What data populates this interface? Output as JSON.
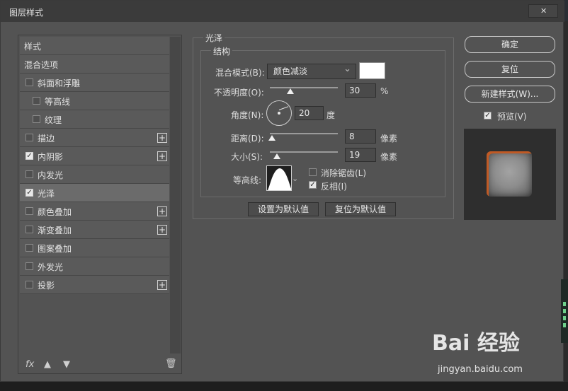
{
  "dialog": {
    "title": "图层样式"
  },
  "left_list": {
    "items": [
      {
        "label": "样式",
        "checkbox": false,
        "checked": false,
        "plus": false,
        "indent": 0,
        "selected": false
      },
      {
        "label": "混合选项",
        "checkbox": false,
        "checked": false,
        "plus": false,
        "indent": 0,
        "selected": false
      },
      {
        "label": "斜面和浮雕",
        "checkbox": true,
        "checked": false,
        "plus": false,
        "indent": 0,
        "selected": false
      },
      {
        "label": "等高线",
        "checkbox": true,
        "checked": false,
        "plus": false,
        "indent": 1,
        "selected": false
      },
      {
        "label": "纹理",
        "checkbox": true,
        "checked": false,
        "plus": false,
        "indent": 1,
        "selected": false
      },
      {
        "label": "描边",
        "checkbox": true,
        "checked": false,
        "plus": true,
        "indent": 0,
        "selected": false
      },
      {
        "label": "内阴影",
        "checkbox": true,
        "checked": true,
        "plus": true,
        "indent": 0,
        "selected": false
      },
      {
        "label": "内发光",
        "checkbox": true,
        "checked": false,
        "plus": false,
        "indent": 0,
        "selected": false
      },
      {
        "label": "光泽",
        "checkbox": true,
        "checked": true,
        "plus": false,
        "indent": 0,
        "selected": true
      },
      {
        "label": "颜色叠加",
        "checkbox": true,
        "checked": false,
        "plus": true,
        "indent": 0,
        "selected": false
      },
      {
        "label": "渐变叠加",
        "checkbox": true,
        "checked": false,
        "plus": true,
        "indent": 0,
        "selected": false
      },
      {
        "label": "图案叠加",
        "checkbox": true,
        "checked": false,
        "plus": false,
        "indent": 0,
        "selected": false
      },
      {
        "label": "外发光",
        "checkbox": true,
        "checked": false,
        "plus": false,
        "indent": 0,
        "selected": false
      },
      {
        "label": "投影",
        "checkbox": true,
        "checked": false,
        "plus": true,
        "indent": 0,
        "selected": false
      }
    ],
    "footer": {
      "fx_label": "fx",
      "icons": [
        "move-up-icon",
        "move-down-icon",
        "trash-icon"
      ]
    }
  },
  "satin": {
    "group_title": "光泽",
    "structure_title": "结构",
    "blend_mode": {
      "label": "混合模式(B):",
      "value": "颜色减淡"
    },
    "opacity": {
      "label": "不透明度(O):",
      "value": "30",
      "unit": "%",
      "level": 0.3
    },
    "angle": {
      "label": "角度(N):",
      "value": "20",
      "unit": "度"
    },
    "distance": {
      "label": "距离(D):",
      "value": "8",
      "unit": "像素",
      "level": 0.03
    },
    "size": {
      "label": "大小(S):",
      "value": "19",
      "unit": "像素",
      "level": 0.1
    },
    "contour": {
      "label": "等高线:"
    },
    "anti_alias": {
      "label": "消除锯齿(L)",
      "checked": false
    },
    "invert": {
      "label": "反相(I)",
      "checked": true
    },
    "set_default_label": "设置为默认值",
    "reset_default_label": "复位为默认值"
  },
  "right": {
    "ok_label": "确定",
    "reset_label": "复位",
    "new_style_label": "新建样式(W)...",
    "preview_label": "预览(V)",
    "preview_checked": true
  },
  "watermark": {
    "brand": "Bai 经验",
    "url": "jingyan.baidu.com"
  },
  "colors": {
    "panel": "#535353",
    "accent_swatch": "#ffffff",
    "preview_orange": "#c05a25"
  }
}
